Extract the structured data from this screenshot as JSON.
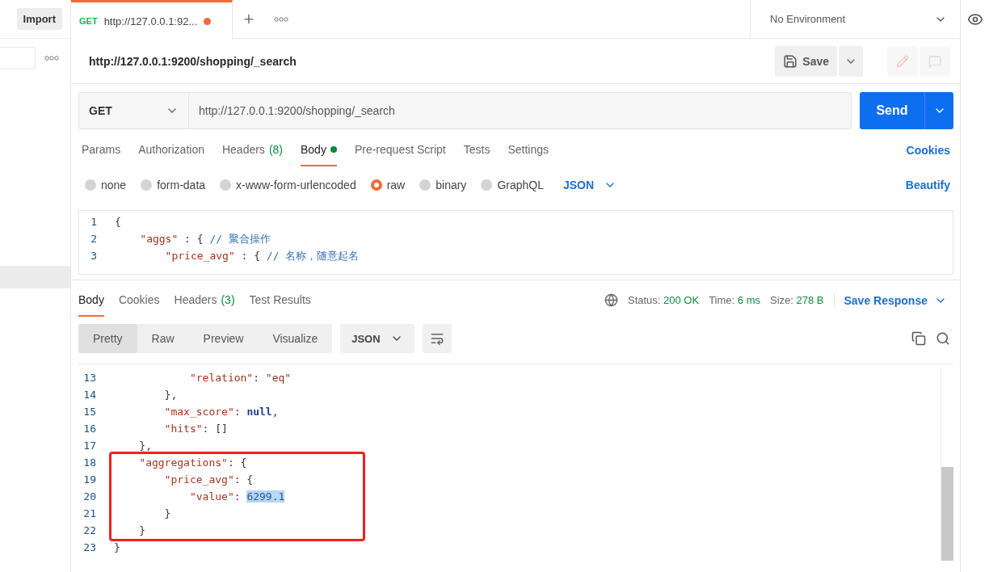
{
  "sidebar": {
    "import_button": "Import"
  },
  "tab_bar": {
    "tabs": [
      {
        "method": "GET",
        "title": "http://127.0.0.1:92...",
        "unsaved": true,
        "selected": true
      }
    ],
    "new_tab": "+",
    "environment": "No Environment"
  },
  "request": {
    "title": "http://127.0.0.1:9200/shopping/_search",
    "save": "Save",
    "method": "GET",
    "url": "http://127.0.0.1:9200/shopping/_search",
    "send": "Send"
  },
  "request_tabs": [
    {
      "label": "Params",
      "selected": false
    },
    {
      "label": "Authorization",
      "selected": false
    },
    {
      "label": "Headers",
      "count": "(8)",
      "selected": false
    },
    {
      "label": "Body",
      "selected": true,
      "modified": true
    },
    {
      "label": "Pre-request Script",
      "selected": false
    },
    {
      "label": "Tests",
      "selected": false
    },
    {
      "label": "Settings",
      "selected": false
    }
  ],
  "cookies_link": "Cookies",
  "body_types": [
    {
      "label": "none",
      "selected": false
    },
    {
      "label": "form-data",
      "selected": false
    },
    {
      "label": "x-www-form-urlencoded",
      "selected": false
    },
    {
      "label": "raw",
      "selected": true
    },
    {
      "label": "binary",
      "selected": false
    },
    {
      "label": "GraphQL",
      "selected": false
    }
  ],
  "raw_format": "JSON",
  "beautify": "Beautify",
  "request_editor": [
    {
      "number": "1",
      "tokens": [
        {
          "kind": "punct",
          "text": "{"
        }
      ]
    },
    {
      "number": "2",
      "tokens": [
        {
          "kind": "key",
          "text": "    \"aggs\""
        },
        {
          "kind": "punct",
          "text": " : { "
        },
        {
          "kind": "comment",
          "text": "// 聚合操作"
        }
      ]
    },
    {
      "number": "3",
      "tokens": [
        {
          "kind": "key",
          "text": "        \"price_avg\""
        },
        {
          "kind": "punct",
          "text": " : { "
        },
        {
          "kind": "comment",
          "text": "// 名称，随意起名"
        }
      ]
    }
  ],
  "response_tabs": [
    {
      "label": "Body",
      "selected": true
    },
    {
      "label": "Cookies",
      "selected": false
    },
    {
      "label": "Headers",
      "count": "(3)",
      "selected": false
    },
    {
      "label": "Test Results",
      "selected": false
    }
  ],
  "response_meta": [
    {
      "label": "Status:",
      "value": "200 OK"
    },
    {
      "label": "Time:",
      "value": "6 ms"
    },
    {
      "label": "Size:",
      "value": "278 B"
    }
  ],
  "save_response": "Save Response",
  "view_modes": [
    {
      "label": "Pretty",
      "selected": true
    },
    {
      "label": "Raw",
      "selected": false
    },
    {
      "label": "Preview",
      "selected": false
    },
    {
      "label": "Visualize",
      "selected": false
    }
  ],
  "response_format": "JSON",
  "response_code": [
    {
      "number": "13",
      "framed": false,
      "tokens": [
        {
          "kind": "key",
          "text": "            \"relation\""
        },
        {
          "kind": "punct",
          "text": ": "
        },
        {
          "kind": "string",
          "text": "\"eq\""
        }
      ]
    },
    {
      "number": "14",
      "framed": false,
      "tokens": [
        {
          "kind": "punct",
          "text": "        },"
        }
      ]
    },
    {
      "number": "15",
      "framed": false,
      "tokens": [
        {
          "kind": "key",
          "text": "        \"max_score\""
        },
        {
          "kind": "punct",
          "text": ": "
        },
        {
          "kind": "null",
          "text": "null"
        },
        {
          "kind": "punct",
          "text": ","
        }
      ]
    },
    {
      "number": "16",
      "framed": false,
      "tokens": [
        {
          "kind": "key",
          "text": "        \"hits\""
        },
        {
          "kind": "punct",
          "text": ": []"
        }
      ]
    },
    {
      "number": "17",
      "framed": false,
      "tokens": [
        {
          "kind": "punct",
          "text": "    },"
        }
      ]
    },
    {
      "number": "18",
      "framed": true,
      "tokens": [
        {
          "kind": "key",
          "text": "    \"aggregations\""
        },
        {
          "kind": "punct",
          "text": ": {"
        }
      ]
    },
    {
      "number": "19",
      "framed": true,
      "tokens": [
        {
          "kind": "key",
          "text": "        \"price_avg\""
        },
        {
          "kind": "punct",
          "text": ": {"
        }
      ]
    },
    {
      "number": "20",
      "framed": true,
      "tokens": [
        {
          "kind": "key",
          "text": "            \"value\""
        },
        {
          "kind": "punct",
          "text": ": "
        },
        {
          "kind": "selected",
          "text": "6299.1"
        }
      ]
    },
    {
      "number": "21",
      "framed": true,
      "tokens": [
        {
          "kind": "punct",
          "text": "        }"
        }
      ]
    },
    {
      "number": "22",
      "framed": true,
      "tokens": [
        {
          "kind": "punct",
          "text": "    }"
        }
      ]
    },
    {
      "number": "23",
      "framed": false,
      "tokens": [
        {
          "kind": "punct",
          "text": "}"
        }
      ]
    }
  ]
}
